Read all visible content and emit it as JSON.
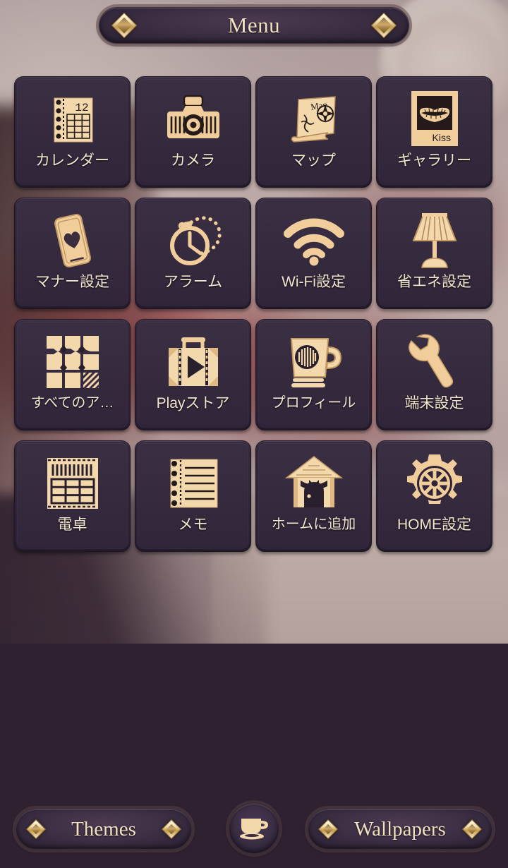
{
  "theme": {
    "background_color": "#2e2130",
    "tile_color": "#362a3e",
    "icon_color": "#f0cd9a",
    "label_color": "#f2e6cf",
    "accent_gold": "#f1e2c2"
  },
  "header": {
    "title": "Menu",
    "left_ornament": "diamond-ornament",
    "right_ornament": "diamond-ornament"
  },
  "grid": {
    "columns": 4,
    "rows": 4,
    "items": [
      {
        "label": "カレンダー",
        "icon": "calendar-icon",
        "badge": "12"
      },
      {
        "label": "カメラ",
        "icon": "camera-icon"
      },
      {
        "label": "マップ",
        "icon": "map-icon",
        "badge": "Map"
      },
      {
        "label": "ギャラリー",
        "icon": "gallery-kiss-icon",
        "badge": "Kiss"
      },
      {
        "label": "マナー設定",
        "icon": "manner-mode-icon"
      },
      {
        "label": "アラーム",
        "icon": "alarm-clock-icon"
      },
      {
        "label": "Wi-Fi設定",
        "icon": "wifi-icon"
      },
      {
        "label": "省エネ設定",
        "icon": "lamp-icon"
      },
      {
        "label": "すべてのア…",
        "icon": "all-apps-icon"
      },
      {
        "label": "Playストア",
        "icon": "play-store-suitcase-icon"
      },
      {
        "label": "プロフィール",
        "icon": "coffee-mug-icon"
      },
      {
        "label": "端末設定",
        "icon": "wrench-icon"
      },
      {
        "label": "電卓",
        "icon": "calculator-icon"
      },
      {
        "label": "メモ",
        "icon": "memo-notepad-icon"
      },
      {
        "label": "ホームに追加",
        "icon": "house-icon"
      },
      {
        "label": "HOME設定",
        "icon": "gear-icon"
      }
    ]
  },
  "dock": {
    "themes_label": "Themes",
    "wallpapers_label": "Wallpapers",
    "home_icon": "coffee-cup-icon"
  }
}
